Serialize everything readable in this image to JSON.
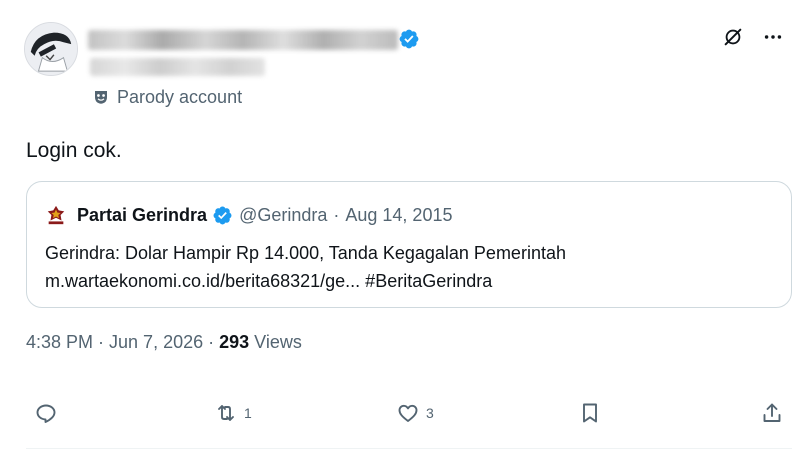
{
  "author": {
    "name_redacted": true,
    "handle_redacted": true,
    "verified": true,
    "label_text": "Parody account"
  },
  "tweet": {
    "text": "Login cok."
  },
  "quoted": {
    "name": "Partai Gerindra",
    "verified": true,
    "handle": "@Gerindra",
    "separator": "·",
    "date": "Aug 14, 2015",
    "line1": "Gerindra: Dolar Hampir Rp 14.000, Tanda Kegagalan Pemerintah",
    "line2": "m.wartaekonomi.co.id/berita68321/ge... #BeritaGerindra"
  },
  "meta": {
    "time_date": "4:38 PM · Jun 7, 2026 · ",
    "views_count": "293",
    "views_label": " Views"
  },
  "actions": {
    "reply_count": "",
    "repost_count": "1",
    "like_count": "3"
  },
  "colors": {
    "verified_blue": "#1d9bf0",
    "secondary_text": "#536471",
    "primary_text": "#0f1419",
    "border": "#cfd9de"
  },
  "icons": {
    "grok": "grok-icon",
    "more": "more-icon",
    "parody": "mask-icon",
    "reply": "reply-icon",
    "repost": "repost-icon",
    "like": "heart-icon",
    "bookmark": "bookmark-icon",
    "share": "share-icon"
  }
}
